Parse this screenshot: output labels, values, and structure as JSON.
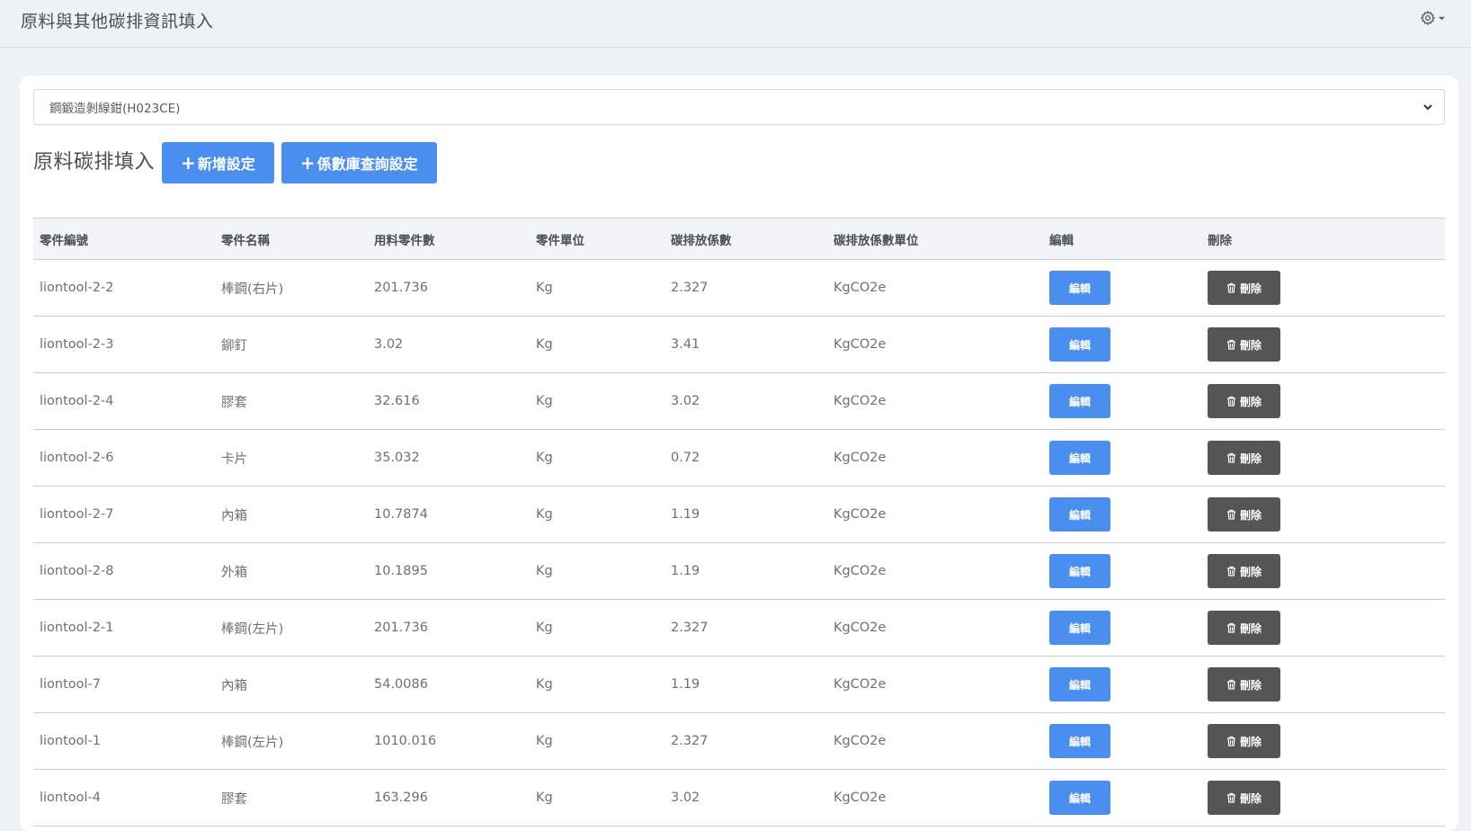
{
  "header": {
    "title": "原料與其他碳排資訊填入"
  },
  "product_select": {
    "value": "鋼鍛造剝線鉗(H023CE)"
  },
  "section": {
    "title": "原料碳排填入",
    "add_label": "新增設定",
    "query_label": "係數庫查詢設定"
  },
  "table": {
    "columns": [
      "零件編號",
      "零件名稱",
      "用料零件數",
      "零件單位",
      "碳排放係數",
      "碳排放係數單位",
      "編輯",
      "刪除"
    ],
    "edit_label": "編輯",
    "delete_label": "刪除",
    "rows": [
      {
        "part_no": "liontool-2-2",
        "name": "棒鋼(右片)",
        "qty": "201.736",
        "unit": "Kg",
        "factor": "2.327",
        "factor_unit": "KgCO2e"
      },
      {
        "part_no": "liontool-2-3",
        "name": "鉚釘",
        "qty": "3.02",
        "unit": "Kg",
        "factor": "3.41",
        "factor_unit": "KgCO2e"
      },
      {
        "part_no": "liontool-2-4",
        "name": "膠套",
        "qty": "32.616",
        "unit": "Kg",
        "factor": "3.02",
        "factor_unit": "KgCO2e"
      },
      {
        "part_no": "liontool-2-6",
        "name": "卡片",
        "qty": "35.032",
        "unit": "Kg",
        "factor": "0.72",
        "factor_unit": "KgCO2e"
      },
      {
        "part_no": "liontool-2-7",
        "name": "內箱",
        "qty": "10.7874",
        "unit": "Kg",
        "factor": "1.19",
        "factor_unit": "KgCO2e"
      },
      {
        "part_no": "liontool-2-8",
        "name": "外箱",
        "qty": "10.1895",
        "unit": "Kg",
        "factor": "1.19",
        "factor_unit": "KgCO2e"
      },
      {
        "part_no": "liontool-2-1",
        "name": "棒鋼(左片)",
        "qty": "201.736",
        "unit": "Kg",
        "factor": "2.327",
        "factor_unit": "KgCO2e"
      },
      {
        "part_no": "liontool-7",
        "name": "內箱",
        "qty": "54.0086",
        "unit": "Kg",
        "factor": "1.19",
        "factor_unit": "KgCO2e"
      },
      {
        "part_no": "liontool-1",
        "name": "棒鋼(左片)",
        "qty": "1010.016",
        "unit": "Kg",
        "factor": "2.327",
        "factor_unit": "KgCO2e"
      },
      {
        "part_no": "liontool-4",
        "name": "膠套",
        "qty": "163.296",
        "unit": "Kg",
        "factor": "3.02",
        "factor_unit": "KgCO2e"
      }
    ]
  },
  "icons": {
    "settings": "gear-icon",
    "select_caret": "chevron-down-icon",
    "delete": "trash-icon"
  },
  "colors": {
    "primary": "#4a8ef0",
    "danger_dark": "#555555",
    "background": "#eef1f5"
  }
}
